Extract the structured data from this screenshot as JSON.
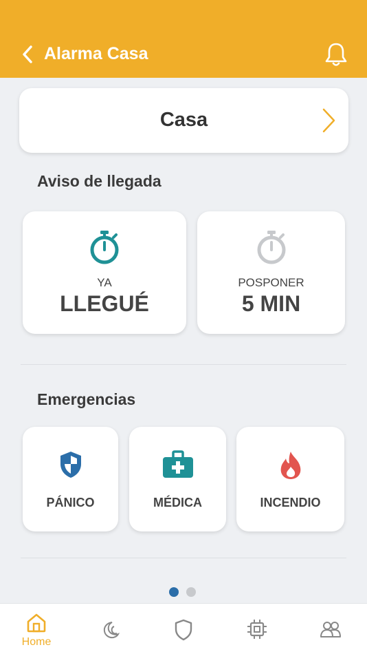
{
  "header": {
    "title": "Alarma Casa"
  },
  "location": {
    "name": "Casa"
  },
  "arrival": {
    "title": "Aviso de llegada",
    "arrived": {
      "small": "YA",
      "big": "LLEGUÉ"
    },
    "postpone": {
      "small": "POSPONER",
      "big": "5 MIN"
    }
  },
  "emergencies": {
    "title": "Emergencias",
    "panic": "PÁNICO",
    "medical": "MÉDICA",
    "fire": "INCENDIO"
  },
  "pager": {
    "count": 2,
    "active_index": 0
  },
  "tabs": [
    {
      "label": "Home",
      "icon": "home-icon",
      "active": true
    },
    {
      "label": "",
      "icon": "moon-icon",
      "active": false
    },
    {
      "label": "",
      "icon": "shield-icon",
      "active": false
    },
    {
      "label": "",
      "icon": "chip-icon",
      "active": false
    },
    {
      "label": "",
      "icon": "users-icon",
      "active": false
    }
  ],
  "colors": {
    "accent": "#f0ae29",
    "teal": "#1f9196",
    "panic_blue": "#2b6ea9",
    "fire_red": "#e2554f",
    "inactive_gray": "#c7c9cc"
  }
}
